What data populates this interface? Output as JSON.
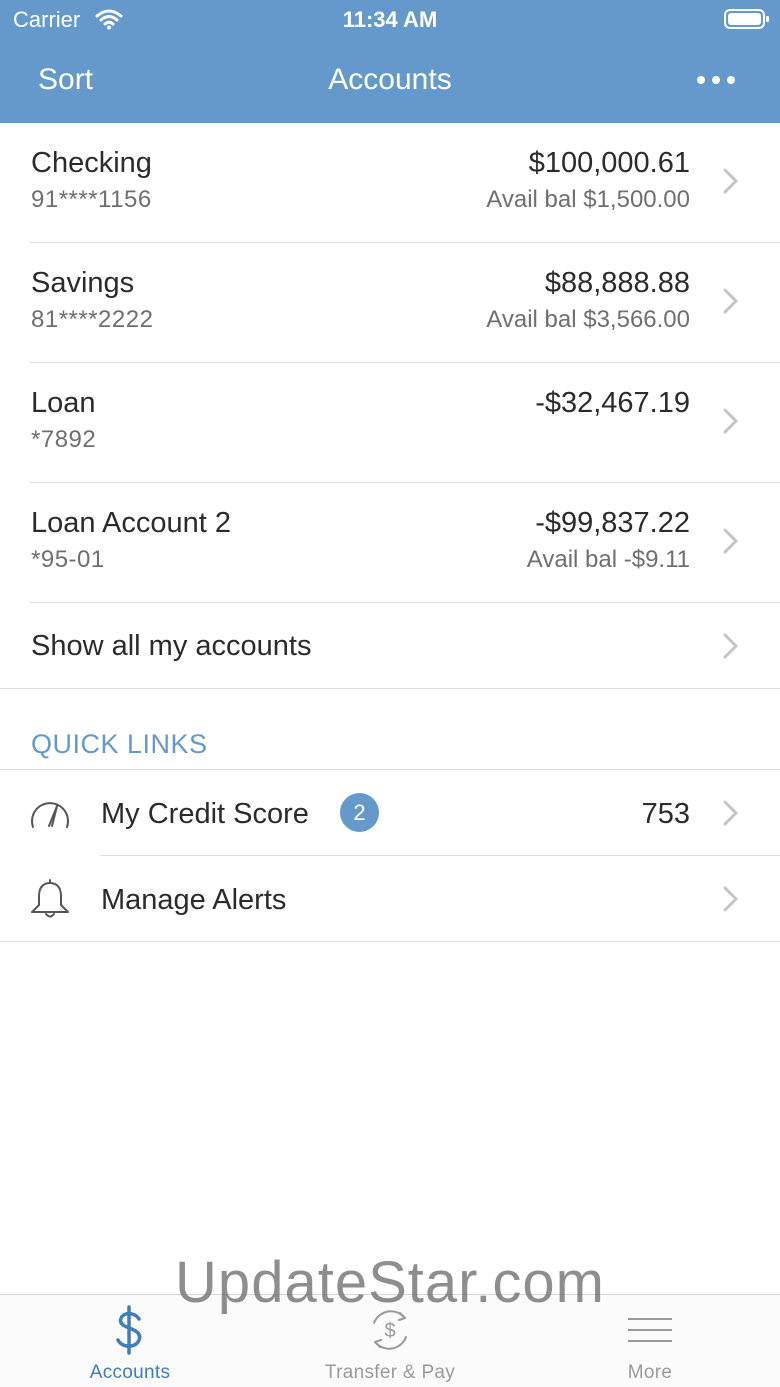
{
  "status_bar": {
    "carrier": "Carrier",
    "time": "11:34 AM"
  },
  "nav": {
    "sort_label": "Sort",
    "title": "Accounts",
    "more_icon": "ellipsis-icon"
  },
  "accounts": [
    {
      "name": "Checking",
      "number": "91****1156",
      "balance": "$100,000.61",
      "avail": "Avail bal $1,500.00"
    },
    {
      "name": "Savings",
      "number": "81****2222",
      "balance": "$88,888.88",
      "avail": "Avail bal $3,566.00"
    },
    {
      "name": "Loan",
      "number": "*7892",
      "balance": "-$32,467.19",
      "avail": ""
    },
    {
      "name": "Loan Account 2",
      "number": "*95-01",
      "balance": "-$99,837.22",
      "avail": "Avail bal -$9.11"
    }
  ],
  "show_all": {
    "label": "Show all my accounts"
  },
  "quick_links": {
    "title": "QUICK LINKS",
    "items": [
      {
        "icon": "gauge-icon",
        "label": "My Credit Score",
        "badge": "2",
        "value": "753"
      },
      {
        "icon": "bell-icon",
        "label": "Manage Alerts"
      }
    ]
  },
  "watermark": "UpdateStar.com",
  "tab_bar": {
    "tabs": [
      {
        "icon": "dollar-icon",
        "label": "Accounts",
        "active": true
      },
      {
        "icon": "transfer-dollar-icon",
        "label": "Transfer & Pay"
      },
      {
        "icon": "menu-icon",
        "label": "More"
      }
    ]
  },
  "colors": {
    "header": "#6599cb",
    "accent": "#3f7cc0",
    "badge": "#6599cb"
  }
}
